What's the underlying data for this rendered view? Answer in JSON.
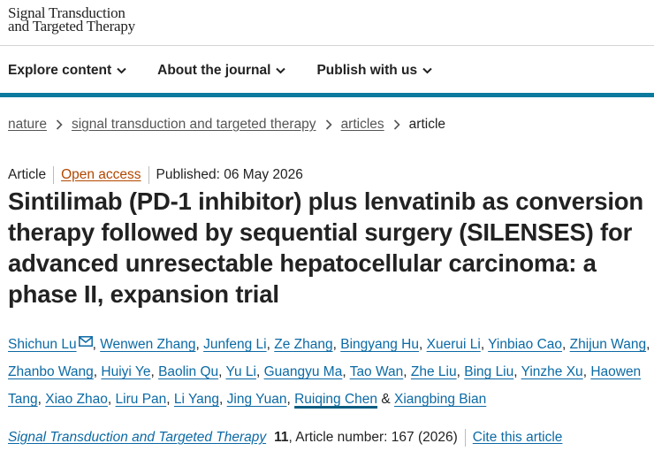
{
  "header": {
    "logo_line1": "Signal Transduction",
    "logo_line2": "and Targeted Therapy"
  },
  "nav": [
    {
      "label": "Explore content",
      "icon": "chevron-down-icon"
    },
    {
      "label": "About the journal",
      "icon": "chevron-down-icon"
    },
    {
      "label": "Publish with us",
      "icon": "chevron-down-icon"
    }
  ],
  "breadcrumb": {
    "items": [
      "nature",
      "signal transduction and targeted therapy",
      "articles"
    ],
    "current": "article"
  },
  "article": {
    "type": "Article",
    "access": "Open access",
    "published": "Published: 06 May 2026",
    "title": "Sintilimab (PD-1 inhibitor) plus lenvatinib as conversion therapy followed by sequential surgery (SILENSES) for advanced unresectable hepatocellular carcinoma: a phase II, expansion trial"
  },
  "authors": [
    "Shichun Lu",
    "Wenwen Zhang",
    "Junfeng Li",
    "Ze Zhang",
    "Bingyang Hu",
    "Xuerui Li",
    "Yinbiao Cao",
    "Zhijun Wang",
    "Zhanbo Wang",
    "Huiyi Ye",
    "Baolin Qu",
    "Yu Li",
    "Guangyu Ma",
    "Tao Wan",
    "Zhe Liu",
    "Bing Liu",
    "Yinzhe Xu",
    "Haowen Tang",
    "Xiao Zhao",
    "Liru Pan",
    "Li Yang",
    "Jing Yuan",
    "Ruiqing Chen",
    "Xiangbing Bian"
  ],
  "citation": {
    "journal": "Signal Transduction and Targeted Therapy",
    "volume": "11",
    "article_number": ", Article number: 167 (2026)",
    "cite_link": "Cite this article"
  },
  "colors": {
    "accent_bar": "#0b7a9e",
    "link": "#0c6aa5",
    "open_access": "#b34700"
  }
}
